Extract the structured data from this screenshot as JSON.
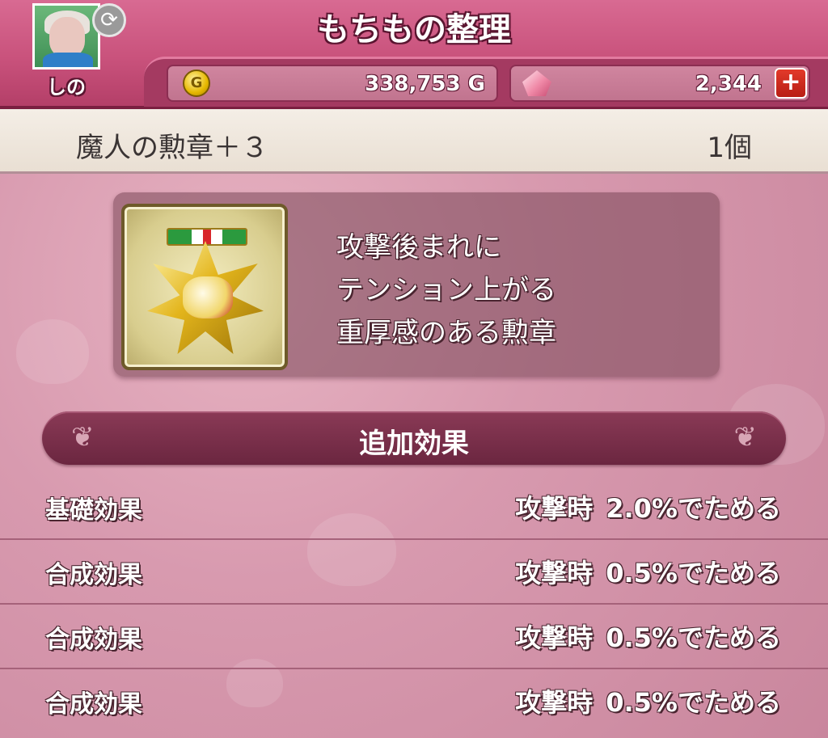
{
  "header": {
    "title": "もちもの整理",
    "player_name": "しの",
    "gold_amount": "338,753 G",
    "gem_amount": "2,344"
  },
  "item": {
    "name": "魔人の勲章＋３",
    "count": "1個",
    "description": [
      "攻撃後まれに",
      "テンション上がる",
      "重厚感のある勲章"
    ]
  },
  "section": {
    "title": "追加効果"
  },
  "effects": [
    {
      "label": "基礎効果",
      "condition": "攻撃時",
      "value": "2.0%でためる"
    },
    {
      "label": "合成効果",
      "condition": "攻撃時",
      "value": "0.5%でためる"
    },
    {
      "label": "合成効果",
      "condition": "攻撃時",
      "value": "0.5%でためる"
    },
    {
      "label": "合成効果",
      "condition": "攻撃時",
      "value": "0.5%でためる"
    }
  ],
  "icons": {
    "gold": "gold-coin-icon",
    "gem": "gem-icon",
    "add": "plus-icon",
    "swap": "swap-icon"
  },
  "colors": {
    "header_pink": "#c9527c",
    "plus_red": "#c8261a",
    "section_band": "#7a2f4a"
  }
}
